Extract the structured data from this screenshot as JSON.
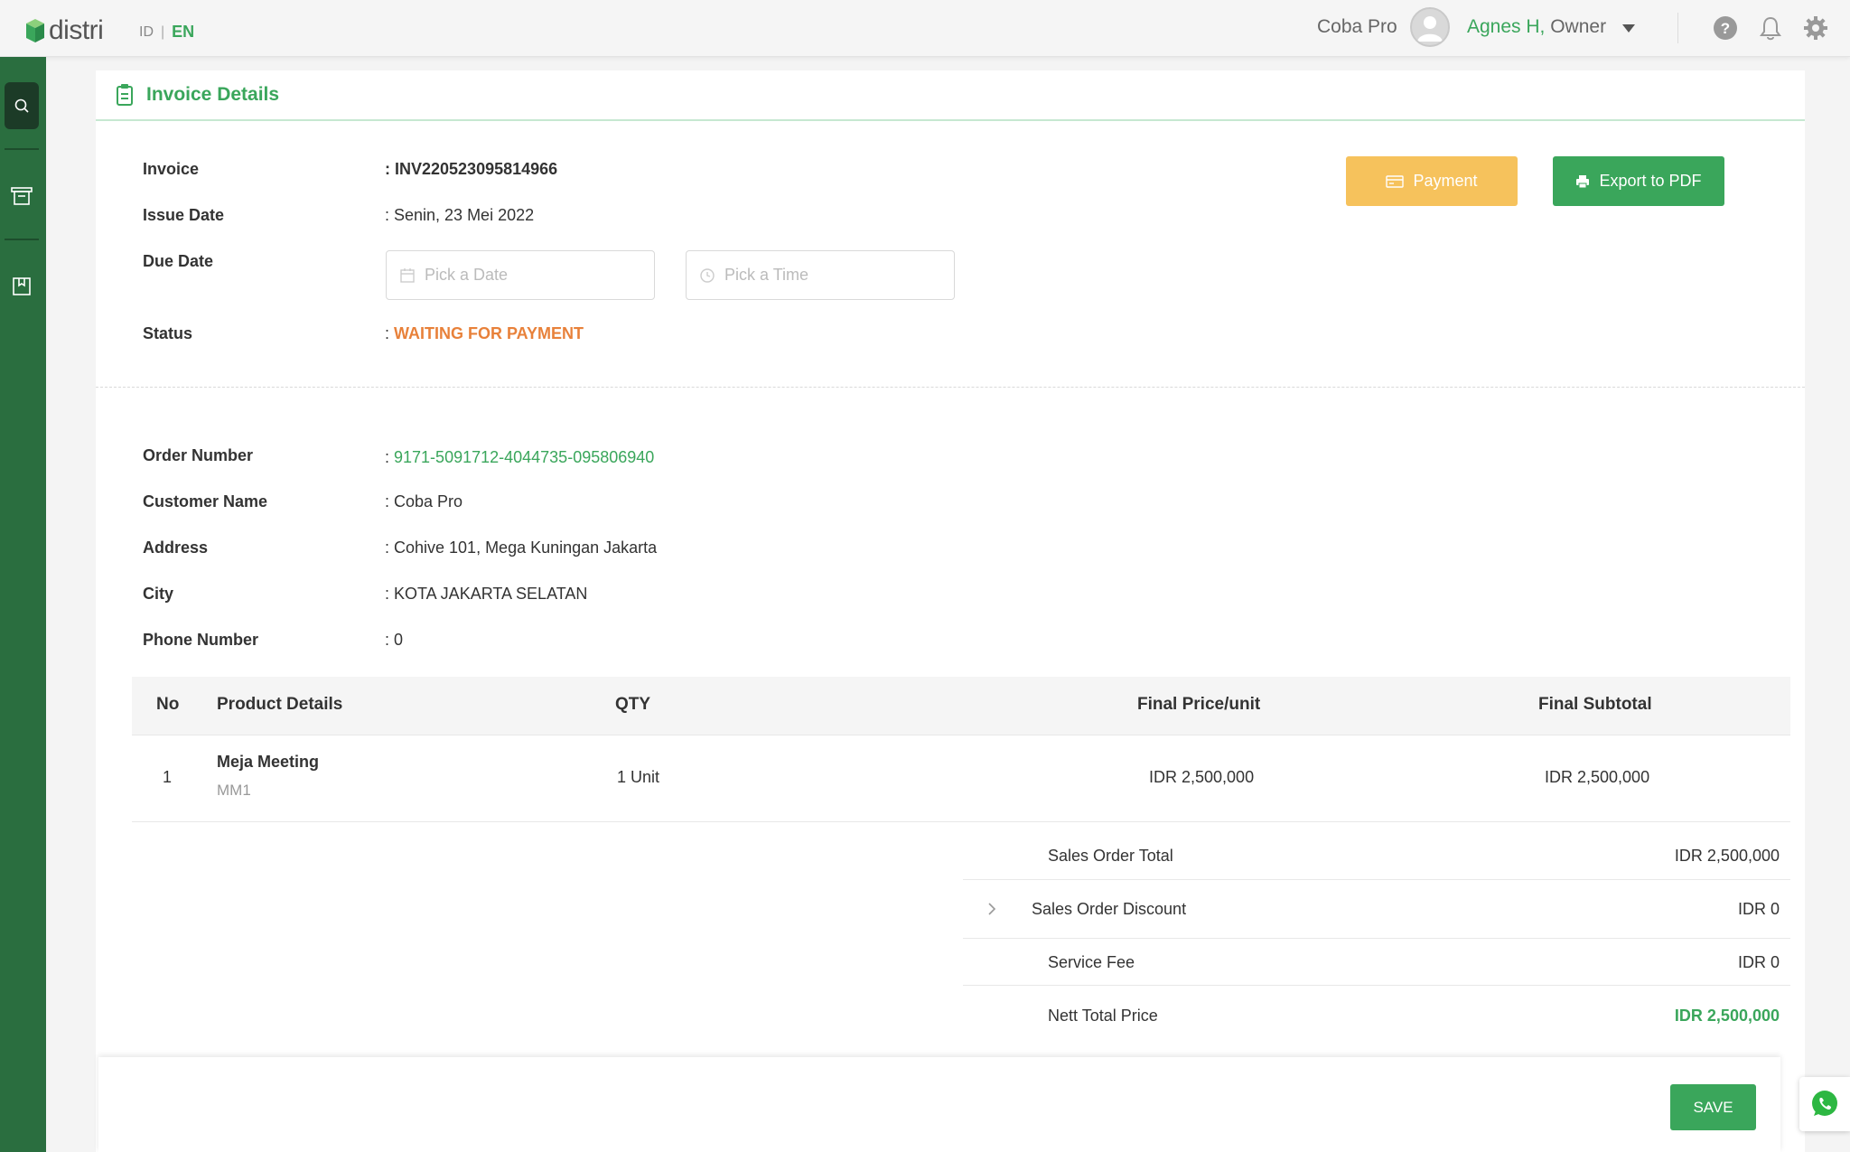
{
  "app": {
    "logo_text": "distri",
    "lang_id": "ID",
    "lang_sep": "|",
    "lang_en": "EN",
    "company": "Coba Pro",
    "user_name": "Agnes H,",
    "user_role": " Owner",
    "icons": [
      "help-icon",
      "bell-icon",
      "gear-icon",
      "search-icon",
      "list-icon",
      "bookmark-icon",
      "whatsapp-icon"
    ],
    "accent": "#3aa65b",
    "sidebar_color": "#2a6e3f"
  },
  "card": {
    "title": "Invoice Details"
  },
  "invoice": {
    "invoice_label": "Invoice",
    "invoice_value": ": INV220523095814966",
    "issue_label": "Issue Date",
    "issue_value": ": Senin, 23 Mei 2022",
    "due_label": "Due Date",
    "date_placeholder": "Pick a Date",
    "time_placeholder": "Pick a Time",
    "status_label": "Status",
    "status_prefix": ": ",
    "status_value": "WAITING FOR PAYMENT",
    "status_color": "#e8813a"
  },
  "actions": {
    "payment_label": "Payment",
    "payment_color": "#f6c25c",
    "export_label": "Export to PDF",
    "save_label": "SAVE"
  },
  "customer": {
    "order_label": "Order Number",
    "order_prefix": ": ",
    "order_value": "9171-5091712-4044735-095806940",
    "name_label": "Customer Name",
    "name_value": ": Coba Pro",
    "address_label": "Address",
    "address_value": ": Cohive 101, Mega Kuningan Jakarta",
    "city_label": "City",
    "city_value": ": KOTA JAKARTA SELATAN",
    "phone_label": "Phone Number",
    "phone_value": ": 0"
  },
  "table": {
    "headers": [
      "No",
      "Product Details",
      "QTY",
      "Final Price/unit",
      "Final Subtotal"
    ],
    "rows": [
      {
        "no": "1",
        "name": "Meja Meeting",
        "code": "MM1",
        "qty": "1 Unit",
        "price": "IDR 2,500,000",
        "subtotal": "IDR 2,500,000"
      }
    ]
  },
  "summary": {
    "total_label": "Sales Order Total",
    "total_value": "IDR 2,500,000",
    "discount_label": "Sales Order Discount",
    "discount_value": "IDR 0",
    "fee_label": "Service Fee",
    "fee_value": "IDR 0",
    "nett_label": "Nett Total Price",
    "nett_value": "IDR 2,500,000"
  }
}
